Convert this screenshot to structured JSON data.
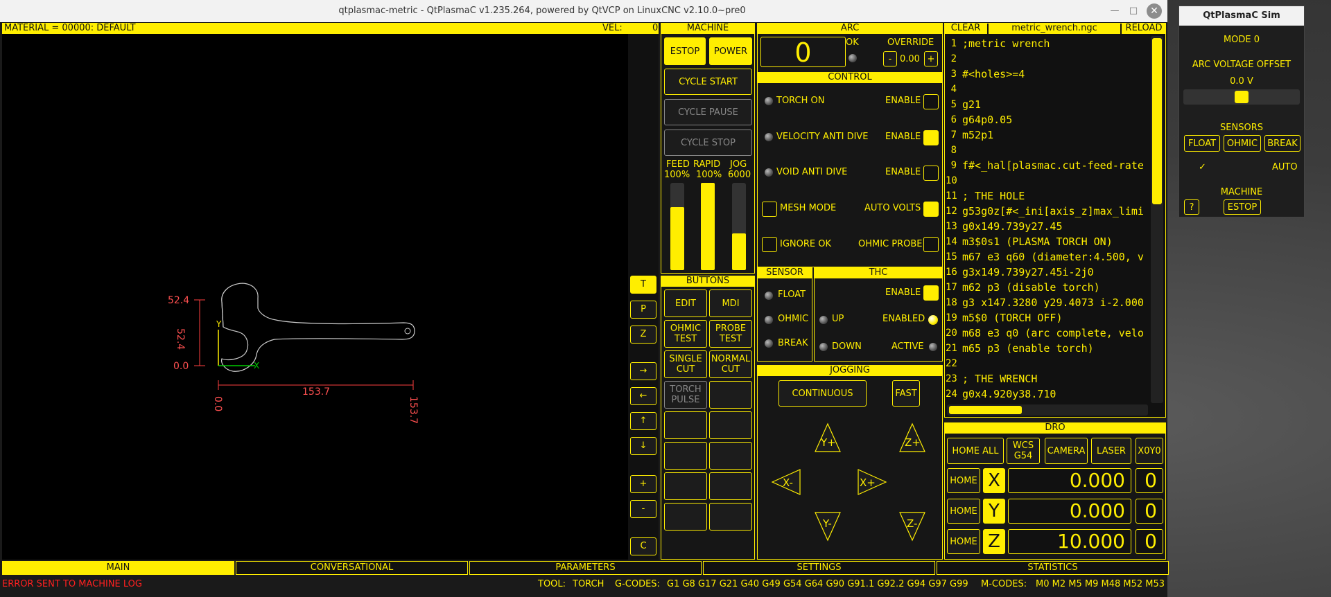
{
  "window": {
    "title": "qtplasmac-metric - QtPlasmaC v1.235.264, powered by QtVCP on LinuxCNC v2.10.0~pre0"
  },
  "header": {
    "material": "MATERIAL =  00000: DEFAULT",
    "vel_label": "VEL:",
    "vel_value": "0"
  },
  "preview": {
    "dims": {
      "y_top": "52.4",
      "y_side": "52.4",
      "y_bottom": "0.0",
      "x_left": "0.0",
      "x_length": "153.7",
      "x_right": "153.7"
    },
    "axis_x": "X",
    "axis_y": "Y",
    "view_buttons": [
      "T",
      "P",
      "Z",
      "→",
      "←",
      "↑",
      "↓",
      "+",
      "-",
      "C"
    ]
  },
  "machine": {
    "title": "MACHINE",
    "estop": "ESTOP",
    "power": "POWER",
    "cycle_start": "CYCLE START",
    "cycle_pause": "CYCLE PAUSE",
    "cycle_stop": "CYCLE STOP",
    "feed_label": "FEED",
    "feed_val": "100%",
    "rapid_label": "RAPID",
    "rapid_val": "100%",
    "jog_label": "JOG",
    "jog_val": "6000",
    "feed_level": 0.72,
    "rapid_level": 1.0,
    "jog_level": 0.42
  },
  "buttons": {
    "title": "BUTTONS",
    "items": [
      "EDIT",
      "MDI",
      "OHMIC\nTEST",
      "PROBE\nTEST",
      "SINGLE\nCUT",
      "NORMAL\nCUT",
      "TORCH\nPULSE",
      "",
      "",
      "",
      "",
      "",
      "",
      "",
      "",
      ""
    ]
  },
  "arc": {
    "title": "ARC",
    "value": "0",
    "ok": "OK",
    "override": "OVERRIDE",
    "minus": "-",
    "plus": "+",
    "override_val": "0.00"
  },
  "control": {
    "title": "CONTROL",
    "torch_on": "TORCH ON",
    "enable1": "ENABLE",
    "vad": "VELOCITY ANTI DIVE",
    "enable2": "ENABLE",
    "void": "VOID ANTI DIVE",
    "enable3": "ENABLE",
    "mesh": "MESH MODE",
    "auto_volts": "AUTO VOLTS",
    "ignore_ok": "IGNORE OK",
    "ohmic_probe": "OHMIC PROBE"
  },
  "sensor": {
    "title": "SENSOR",
    "float": "FLOAT",
    "ohmic": "OHMIC",
    "break": "BREAK"
  },
  "thc": {
    "title": "THC",
    "enable": "ENABLE",
    "up": "UP",
    "enabled": "ENABLED",
    "down": "DOWN",
    "active": "ACTIVE"
  },
  "jogging": {
    "title": "JOGGING",
    "continuous": "CONTINUOUS",
    "fast": "FAST",
    "yplus": "Y+",
    "zplus": "Z+",
    "xminus": "X-",
    "xplus": "X+",
    "yminus": "Y-",
    "zminus": "Z-"
  },
  "editor": {
    "clear": "CLEAR",
    "file": "metric_wrench.ngc",
    "reload": "RELOAD",
    "lines": [
      {
        "n": "1",
        "t": ";metric wrench"
      },
      {
        "n": "2",
        "t": ""
      },
      {
        "n": "3",
        "t": "#<holes>=4"
      },
      {
        "n": "4",
        "t": ""
      },
      {
        "n": "5",
        "t": "g21"
      },
      {
        "n": "6",
        "t": "g64p0.05"
      },
      {
        "n": "7",
        "t": "m52p1"
      },
      {
        "n": "8",
        "t": ""
      },
      {
        "n": "9",
        "t": "f#<_hal[plasmac.cut-feed-rate"
      },
      {
        "n": "10",
        "t": ""
      },
      {
        "n": "11",
        "t": "; THE HOLE"
      },
      {
        "n": "12",
        "t": "g53g0z[#<_ini[axis_z]max_limi"
      },
      {
        "n": "13",
        "t": "g0x149.739y27.45"
      },
      {
        "n": "14",
        "t": "m3$0s1 (PLASMA TORCH ON)"
      },
      {
        "n": "15",
        "t": "m67 e3 q60 (diameter:4.500, v"
      },
      {
        "n": "16",
        "t": "g3x149.739y27.45i-2j0"
      },
      {
        "n": "17",
        "t": "m62 p3 (disable torch)"
      },
      {
        "n": "18",
        "t": "g3 x147.3280 y29.4073 i-2.000"
      },
      {
        "n": "19",
        "t": "m5$0 (TORCH OFF)"
      },
      {
        "n": "20",
        "t": "m68 e3 q0 (arc complete, velo"
      },
      {
        "n": "21",
        "t": "m65 p3 (enable torch)"
      },
      {
        "n": "22",
        "t": ""
      },
      {
        "n": "23",
        "t": "; THE WRENCH"
      },
      {
        "n": "24",
        "t": "g0x4.920y38.710"
      }
    ]
  },
  "dro": {
    "title": "DRO",
    "home_all": "HOME ALL",
    "wcs": "WCS\nG54",
    "camera": "CAMERA",
    "laser": "LASER",
    "x0y0": "X0Y0",
    "axes": [
      {
        "home": "HOME",
        "axis": "X",
        "value": "0.000",
        "offset": "0"
      },
      {
        "home": "HOME",
        "axis": "Y",
        "value": "0.000",
        "offset": "0"
      },
      {
        "home": "HOME",
        "axis": "Z",
        "value": "10.000",
        "offset": "0"
      }
    ]
  },
  "tabs": [
    "MAIN",
    "CONVERSATIONAL",
    "PARAMETERS",
    "SETTINGS",
    "STATISTICS"
  ],
  "status": {
    "error": "ERROR SENT TO MACHINE LOG",
    "tool_label": "TOOL:",
    "tool": "TORCH",
    "gcodes_label": "G-CODES:",
    "gcodes": "G1 G8 G17 G21 G40 G49 G54 G64 G90 G91.1 G92.2 G94 G97 G99",
    "mcodes_label": "M-CODES:",
    "mcodes": "M0 M2 M5 M9 M48 M52 M53"
  },
  "sim": {
    "title": "QtPlasmaC Sim",
    "mode": "MODE 0",
    "arc_offset": "ARC VOLTAGE OFFSET",
    "arc_val": "0.0 V",
    "sensors": "SENSORS",
    "float": "FLOAT",
    "ohmic": "OHMIC",
    "break": "BREAK",
    "check": "✓",
    "auto": "AUTO",
    "machine": "MACHINE",
    "help": "?",
    "estop": "ESTOP",
    "slider_level": 0.5
  }
}
